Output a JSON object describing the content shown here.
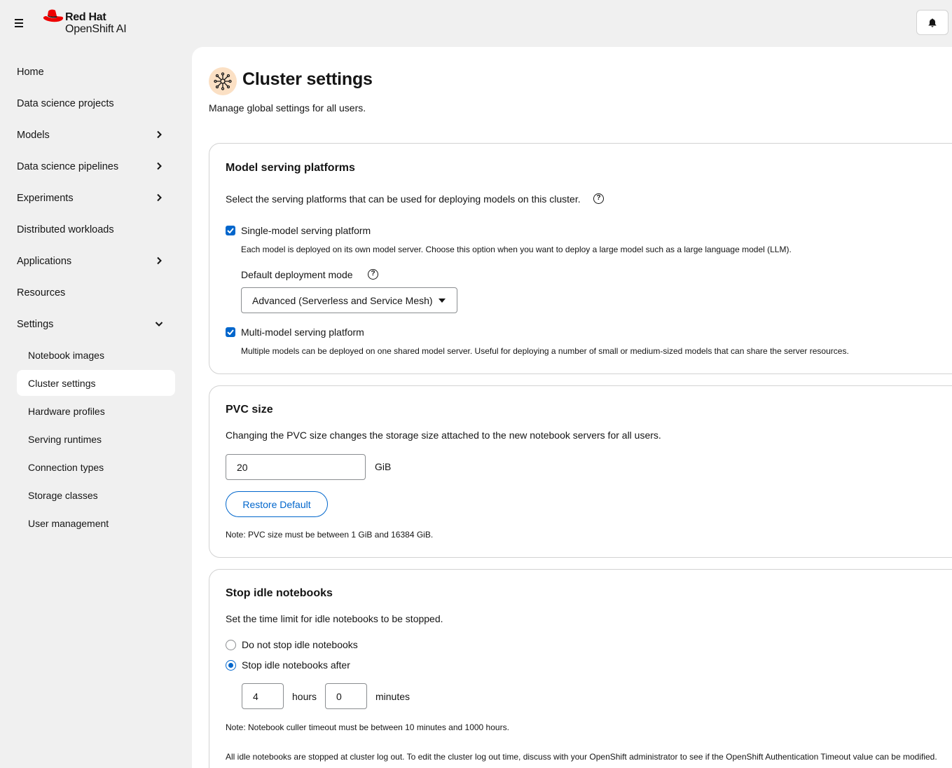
{
  "masthead": {
    "brand": "Red Hat",
    "product": "OpenShift AI",
    "menu_icon": "hamburger-menu-icon",
    "notifications_icon": "bell-icon"
  },
  "sidebar": {
    "items": [
      {
        "label": "Home",
        "expandable": false
      },
      {
        "label": "Data science projects",
        "expandable": false
      },
      {
        "label": "Models",
        "expandable": true
      },
      {
        "label": "Data science pipelines",
        "expandable": true
      },
      {
        "label": "Experiments",
        "expandable": true
      },
      {
        "label": "Distributed workloads",
        "expandable": false
      },
      {
        "label": "Applications",
        "expandable": true
      },
      {
        "label": "Resources",
        "expandable": false
      },
      {
        "label": "Settings",
        "expandable": true,
        "expanded": true
      }
    ],
    "settings_children": [
      {
        "label": "Notebook images"
      },
      {
        "label": "Cluster settings",
        "active": true
      },
      {
        "label": "Hardware profiles"
      },
      {
        "label": "Serving runtimes"
      },
      {
        "label": "Connection types"
      },
      {
        "label": "Storage classes"
      },
      {
        "label": "User management"
      }
    ]
  },
  "page": {
    "title": "Cluster settings",
    "subtitle": "Manage global settings for all users.",
    "icon": "cluster-settings-icon"
  },
  "model_serving": {
    "title": "Model serving platforms",
    "description": "Select the serving platforms that can be used for deploying models on this cluster.",
    "single": {
      "label": "Single-model serving platform",
      "checked": true,
      "help": "Each model is deployed on its own model server. Choose this option when you want to deploy a large model such as a large language model (LLM)."
    },
    "deployment_mode": {
      "label": "Default deployment mode",
      "value": "Advanced (Serverless and Service Mesh)"
    },
    "multi": {
      "label": "Multi-model serving platform",
      "checked": true,
      "help": "Multiple models can be deployed on one shared model server. Useful for deploying a number of small or medium-sized models that can share the server resources."
    }
  },
  "pvc": {
    "title": "PVC size",
    "description": "Changing the PVC size changes the storage size attached to the new notebook servers for all users.",
    "value": "20",
    "unit": "GiB",
    "restore_label": "Restore Default",
    "note": "Note: PVC size must be between 1 GiB and 16384 GiB."
  },
  "idle": {
    "title": "Stop idle notebooks",
    "description": "Set the time limit for idle notebooks to be stopped.",
    "option_no": "Do not stop idle notebooks",
    "option_yes": "Stop idle notebooks after",
    "selected": "option_yes",
    "hours": "4",
    "hours_label": "hours",
    "minutes": "0",
    "minutes_label": "minutes",
    "note": "Note: Notebook culler timeout must be between 10 minutes and 1000 hours.",
    "logout_note": "All idle notebooks are stopped at cluster log out. To edit the cluster log out time, discuss with your OpenShift administrator to see if the OpenShift Authentication Timeout value can be modified."
  },
  "colors": {
    "accent": "#0066cc",
    "background": "#f0f0f0",
    "icon_bg": "#fbe0c4"
  }
}
